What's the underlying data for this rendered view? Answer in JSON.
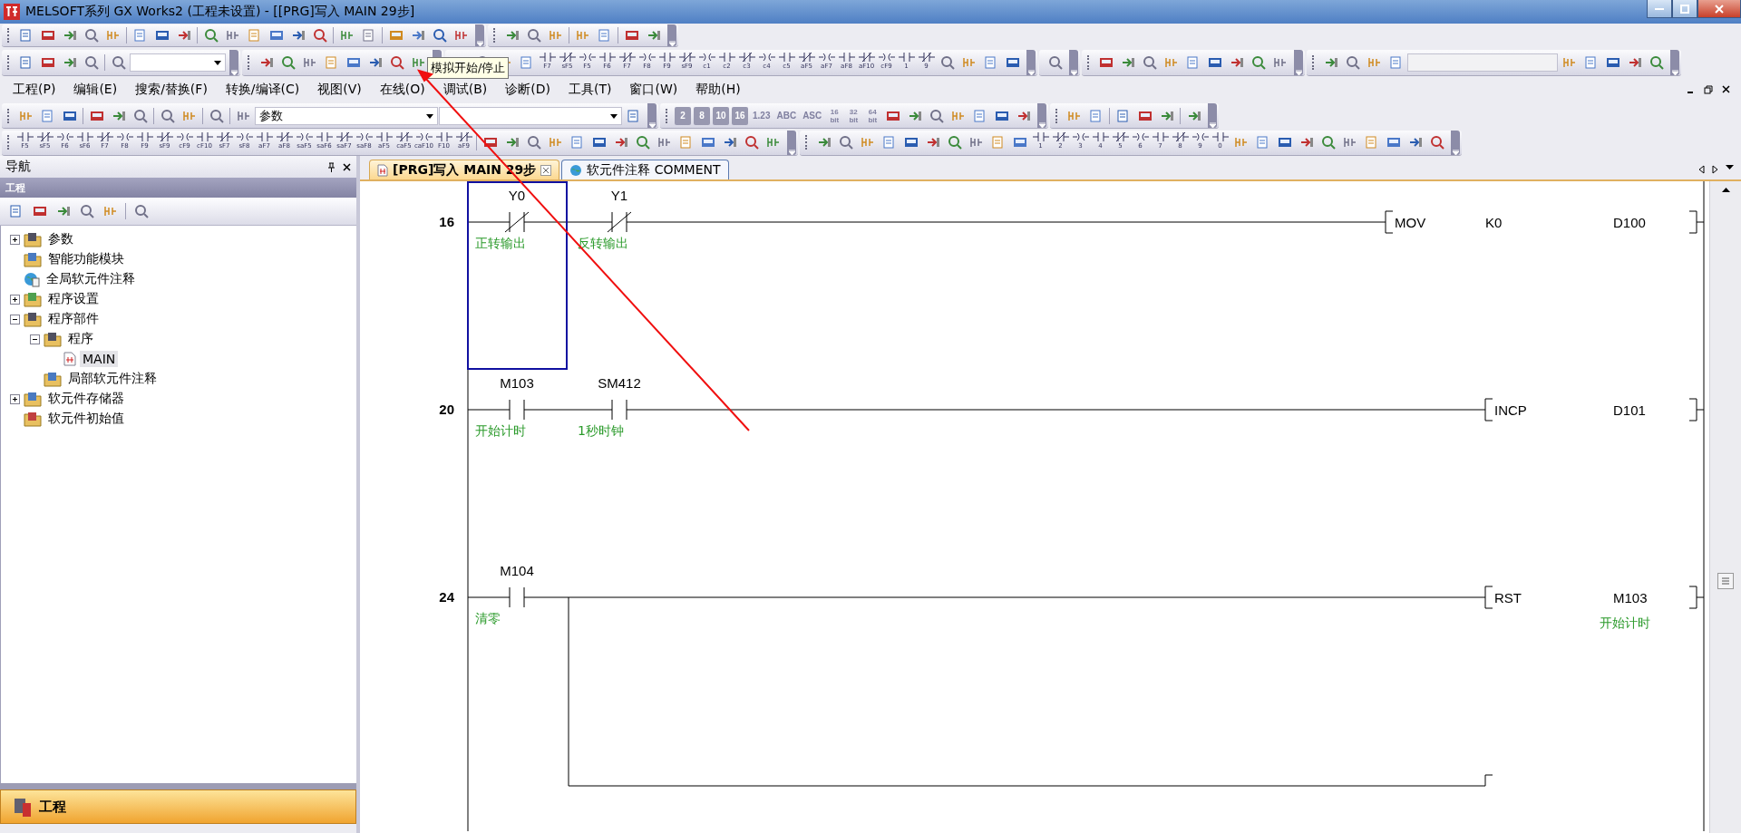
{
  "window": {
    "title": "MELSOFT系列 GX Works2 (工程未设置) - [[PRG]写入 MAIN 29步]"
  },
  "tooltip": {
    "text": "模拟开始/停止"
  },
  "edit_keys": [
    "F7",
    "sF5",
    "F5",
    "F6",
    "F7",
    "F8",
    "F9",
    "sF9",
    "c1",
    "c2",
    "c3",
    "c4",
    "c5",
    "aF5",
    "aF7",
    "aF8",
    "aF10",
    "cF9",
    "1",
    "9"
  ],
  "menu": [
    "工程(P)",
    "编辑(E)",
    "搜索/替换(F)",
    "转换/编译(C)",
    "视图(V)",
    "在线(O)",
    "调试(B)",
    "诊断(D)",
    "工具(T)",
    "窗口(W)",
    "帮助(H)"
  ],
  "combo": {
    "value": "参数"
  },
  "number_buttons": [
    "2",
    "8",
    "10",
    "16",
    "1.23",
    "ABC",
    "ASC",
    "16\nbit",
    "32\nbit",
    "64\nbit"
  ],
  "ladder_keys": [
    "F5",
    "sF5",
    "F6",
    "sF6",
    "F7",
    "F8",
    "F9",
    "sF9",
    "cF9",
    "cF10",
    "sF7",
    "sF8",
    "aF7",
    "aF8",
    "saF5",
    "saF6",
    "saF7",
    "saF8",
    "aF5",
    "caF5",
    "caF10",
    "F10",
    "aF9"
  ],
  "symbol_keys": [
    "1",
    "2",
    "3",
    "4",
    "5",
    "6",
    "7",
    "8",
    "9",
    "0"
  ],
  "navigator": {
    "title": "导航",
    "section": "工程",
    "footer": "工程",
    "tree": [
      {
        "label": "参数",
        "kind": "folder",
        "selected": false,
        "expanded": false
      },
      {
        "label": "智能功能模块",
        "kind": "folder",
        "selected": false
      },
      {
        "label": "全局软元件注释",
        "kind": "comment",
        "selected": false
      },
      {
        "label": "程序设置",
        "kind": "folder",
        "selected": false,
        "expanded": false
      },
      {
        "label": "程序部件",
        "kind": "folder",
        "selected": false,
        "expanded": true,
        "children": [
          {
            "label": "程序",
            "kind": "folder",
            "selected": false,
            "expanded": true,
            "children": [
              {
                "label": "MAIN",
                "kind": "program",
                "selected": true
              }
            ]
          },
          {
            "label": "局部软元件注释",
            "kind": "folder",
            "selected": false
          }
        ]
      },
      {
        "label": "软元件存储器",
        "kind": "folder",
        "selected": false,
        "expanded": false
      },
      {
        "label": "软元件初始值",
        "kind": "folder",
        "selected": false
      }
    ]
  },
  "tabs": [
    {
      "label": "[PRG]写入 MAIN 29步",
      "selected": true
    },
    {
      "label": "软元件注释 COMMENT",
      "selected": false
    }
  ],
  "rungs": [
    {
      "step": "16",
      "branch": false,
      "contacts": [
        {
          "kind": "nc",
          "device": "Y0",
          "comment": "正转输出",
          "selected": true
        },
        {
          "kind": "nc",
          "device": "Y1",
          "comment": "反转输出",
          "selected": false
        }
      ],
      "instruction": {
        "op": "MOV",
        "operands": [
          {
            "text": "K0"
          },
          {
            "text": "D100"
          }
        ]
      }
    },
    {
      "step": "20",
      "branch": false,
      "contacts": [
        {
          "kind": "no",
          "device": "M103",
          "comment": "开始计时",
          "selected": false
        },
        {
          "kind": "no",
          "device": "SM412",
          "comment": "1秒时钟",
          "selected": false
        }
      ],
      "instruction": {
        "op": "INCP",
        "operands": [
          {
            "text": "D101"
          }
        ]
      }
    },
    {
      "step": "24",
      "branch": true,
      "contacts": [
        {
          "kind": "no",
          "device": "M104",
          "comment": "清零",
          "selected": false
        }
      ],
      "instruction": {
        "op": "RST",
        "operands": [
          {
            "text": "M103",
            "comment": "开始计时"
          }
        ]
      }
    }
  ]
}
